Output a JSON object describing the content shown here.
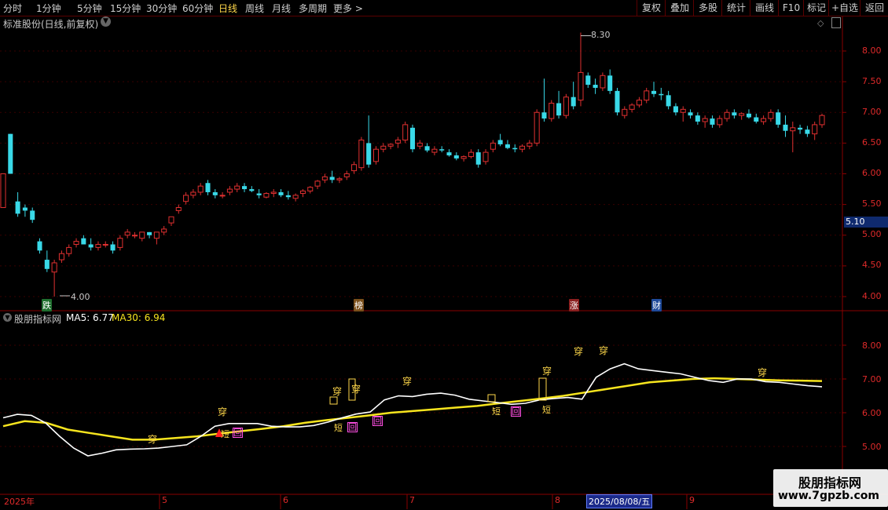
{
  "toolbar": {
    "periods": [
      "分时",
      "1分钟",
      "5分钟",
      "15分钟",
      "30分钟",
      "60分钟",
      "日线",
      "周线",
      "月线",
      "多周期",
      "更多 >"
    ],
    "active_period": "日线",
    "right_buttons": [
      "复权",
      "叠加",
      "多股",
      "统计",
      "画线",
      "F10",
      "标记",
      "+自选",
      "返回"
    ]
  },
  "main_panel": {
    "title": "标准股份(日线,前复权)",
    "high_marker": "8.30",
    "low_marker": "4.00",
    "price_ticks": [
      "8.00",
      "7.50",
      "7.00",
      "6.50",
      "6.00",
      "5.50",
      "5.00",
      "4.50",
      "4.00"
    ],
    "current_price_tag": "5.10",
    "events": [
      {
        "text": "跌",
        "color": "#2aa44a"
      },
      {
        "text": "榜",
        "color": "#c9822a"
      },
      {
        "text": "涨",
        "color": "#c0392b"
      },
      {
        "text": "财",
        "color": "#2a6cd0"
      }
    ]
  },
  "indicator_panel": {
    "name": "股朋指标网",
    "ma5_label": "MA5: 6.77",
    "ma30_label": "MA30: 6.94",
    "ticks": [
      "8.00",
      "7.00",
      "6.00",
      "5.00"
    ],
    "signals": {
      "chuan": "穿",
      "duan": "短",
      "hui": "回"
    }
  },
  "x_axis": {
    "labels": [
      "2025年",
      "5",
      "6",
      "7",
      "8",
      "9"
    ],
    "cursor_date": "2025/08/08/五"
  },
  "watermark": {
    "title": "股朋指标网",
    "url": "www.7gpzb.com"
  },
  "colors": {
    "up": "#e03030",
    "down": "#39d9e8",
    "ma5": "#ffffff",
    "ma30": "#f7e51e",
    "axis": "#8a0000"
  },
  "chart_data": {
    "type": "candlestick",
    "title": "标准股份(日线,前复权)",
    "ylim": [
      3.8,
      8.6
    ],
    "x_labels": [
      "2025年",
      "5",
      "6",
      "7",
      "8",
      "9"
    ],
    "high": 8.3,
    "low": 4.0,
    "ohlc": [
      [
        5.45,
        6.0,
        5.45,
        6.0
      ],
      [
        6.65,
        6.65,
        6.0,
        6.0
      ],
      [
        5.55,
        5.7,
        5.3,
        5.35
      ],
      [
        5.45,
        5.5,
        5.3,
        5.4
      ],
      [
        5.4,
        5.45,
        5.2,
        5.25
      ],
      [
        4.9,
        4.95,
        4.7,
        4.75
      ],
      [
        4.6,
        4.75,
        4.4,
        4.45
      ],
      [
        4.4,
        4.6,
        4.0,
        4.55
      ],
      [
        4.6,
        4.75,
        4.55,
        4.7
      ],
      [
        4.7,
        4.85,
        4.65,
        4.8
      ],
      [
        4.85,
        4.95,
        4.8,
        4.9
      ],
      [
        4.95,
        5.0,
        4.85,
        4.85
      ],
      [
        4.85,
        4.95,
        4.75,
        4.8
      ],
      [
        4.8,
        4.9,
        4.75,
        4.85
      ],
      [
        4.85,
        4.9,
        4.8,
        4.85
      ],
      [
        4.85,
        4.9,
        4.7,
        4.75
      ],
      [
        4.8,
        5.0,
        4.75,
        4.95
      ],
      [
        5.0,
        5.1,
        4.95,
        5.05
      ],
      [
        5.0,
        5.05,
        4.95,
        5.0
      ],
      [
        4.95,
        5.05,
        4.9,
        5.05
      ],
      [
        5.05,
        5.05,
        4.95,
        5.0
      ],
      [
        4.95,
        5.05,
        4.85,
        5.05
      ],
      [
        5.05,
        5.15,
        5.0,
        5.1
      ],
      [
        5.2,
        5.3,
        5.15,
        5.3
      ],
      [
        5.4,
        5.5,
        5.35,
        5.45
      ],
      [
        5.55,
        5.7,
        5.5,
        5.65
      ],
      [
        5.65,
        5.75,
        5.6,
        5.7
      ],
      [
        5.7,
        5.85,
        5.65,
        5.8
      ],
      [
        5.85,
        5.9,
        5.65,
        5.7
      ],
      [
        5.7,
        5.75,
        5.6,
        5.65
      ],
      [
        5.65,
        5.7,
        5.6,
        5.65
      ],
      [
        5.7,
        5.8,
        5.65,
        5.75
      ],
      [
        5.75,
        5.85,
        5.7,
        5.8
      ],
      [
        5.8,
        5.85,
        5.7,
        5.75
      ],
      [
        5.75,
        5.8,
        5.7,
        5.72
      ],
      [
        5.68,
        5.75,
        5.6,
        5.65
      ],
      [
        5.62,
        5.7,
        5.6,
        5.68
      ],
      [
        5.68,
        5.75,
        5.62,
        5.7
      ],
      [
        5.7,
        5.75,
        5.62,
        5.65
      ],
      [
        5.65,
        5.72,
        5.58,
        5.62
      ],
      [
        5.6,
        5.68,
        5.55,
        5.65
      ],
      [
        5.68,
        5.75,
        5.62,
        5.72
      ],
      [
        5.72,
        5.8,
        5.68,
        5.78
      ],
      [
        5.8,
        5.9,
        5.75,
        5.88
      ],
      [
        5.9,
        6.0,
        5.85,
        5.95
      ],
      [
        5.95,
        6.05,
        5.85,
        5.9
      ],
      [
        5.9,
        5.95,
        5.85,
        5.92
      ],
      [
        5.95,
        6.05,
        5.9,
        6.0
      ],
      [
        6.05,
        6.2,
        6.0,
        6.15
      ],
      [
        6.1,
        6.6,
        6.05,
        6.55
      ],
      [
        6.5,
        6.95,
        6.1,
        6.15
      ],
      [
        6.2,
        6.45,
        6.15,
        6.4
      ],
      [
        6.4,
        6.5,
        6.35,
        6.45
      ],
      [
        6.45,
        6.5,
        6.4,
        6.48
      ],
      [
        6.5,
        6.6,
        6.42,
        6.55
      ],
      [
        6.55,
        6.85,
        6.5,
        6.8
      ],
      [
        6.75,
        6.8,
        6.35,
        6.4
      ],
      [
        6.45,
        6.55,
        6.4,
        6.5
      ],
      [
        6.45,
        6.5,
        6.35,
        6.38
      ],
      [
        6.35,
        6.45,
        6.3,
        6.4
      ],
      [
        6.4,
        6.45,
        6.35,
        6.38
      ],
      [
        6.35,
        6.4,
        6.28,
        6.3
      ],
      [
        6.3,
        6.35,
        6.22,
        6.25
      ],
      [
        6.25,
        6.3,
        6.2,
        6.28
      ],
      [
        6.28,
        6.4,
        6.25,
        6.35
      ],
      [
        6.35,
        6.4,
        6.1,
        6.15
      ],
      [
        6.2,
        6.4,
        6.15,
        6.35
      ],
      [
        6.4,
        6.55,
        6.35,
        6.5
      ],
      [
        6.55,
        6.65,
        6.45,
        6.48
      ],
      [
        6.48,
        6.55,
        6.4,
        6.42
      ],
      [
        6.42,
        6.48,
        6.35,
        6.4
      ],
      [
        6.4,
        6.48,
        6.35,
        6.45
      ],
      [
        6.45,
        6.55,
        6.4,
        6.5
      ],
      [
        6.5,
        7.05,
        6.45,
        7.0
      ],
      [
        7.0,
        7.55,
        6.85,
        6.9
      ],
      [
        6.9,
        7.2,
        6.85,
        7.15
      ],
      [
        7.15,
        7.35,
        6.9,
        6.95
      ],
      [
        6.95,
        7.3,
        6.9,
        7.25
      ],
      [
        7.25,
        7.5,
        7.05,
        7.1
      ],
      [
        7.2,
        8.3,
        7.1,
        7.65
      ],
      [
        7.6,
        7.65,
        7.4,
        7.45
      ],
      [
        7.45,
        7.55,
        7.3,
        7.4
      ],
      [
        7.4,
        7.65,
        7.35,
        7.6
      ],
      [
        7.6,
        7.7,
        7.3,
        7.35
      ],
      [
        7.35,
        7.4,
        6.95,
        7.0
      ],
      [
        6.95,
        7.1,
        6.9,
        7.05
      ],
      [
        7.05,
        7.15,
        7.0,
        7.12
      ],
      [
        7.12,
        7.25,
        7.08,
        7.2
      ],
      [
        7.2,
        7.4,
        7.15,
        7.35
      ],
      [
        7.35,
        7.5,
        7.25,
        7.3
      ],
      [
        7.3,
        7.4,
        7.2,
        7.28
      ],
      [
        7.28,
        7.35,
        7.05,
        7.1
      ],
      [
        7.1,
        7.15,
        6.95,
        7.0
      ],
      [
        7.0,
        7.1,
        6.85,
        7.05
      ],
      [
        7.0,
        7.05,
        6.9,
        6.95
      ],
      [
        6.95,
        7.0,
        6.8,
        6.85
      ],
      [
        6.85,
        6.95,
        6.75,
        6.9
      ],
      [
        6.9,
        6.95,
        6.75,
        6.8
      ],
      [
        6.8,
        6.95,
        6.75,
        6.9
      ],
      [
        6.9,
        7.05,
        6.85,
        7.0
      ],
      [
        7.0,
        7.05,
        6.9,
        6.95
      ],
      [
        6.95,
        7.0,
        6.88,
        6.98
      ],
      [
        6.98,
        7.05,
        6.9,
        6.92
      ],
      [
        6.92,
        6.98,
        6.82,
        6.85
      ],
      [
        6.85,
        6.95,
        6.8,
        6.9
      ],
      [
        6.9,
        7.05,
        6.85,
        7.0
      ],
      [
        7.0,
        7.05,
        6.75,
        6.8
      ],
      [
        6.8,
        6.95,
        6.6,
        6.7
      ],
      [
        6.7,
        6.85,
        6.35,
        6.75
      ],
      [
        6.75,
        6.8,
        6.65,
        6.72
      ],
      [
        6.72,
        6.78,
        6.6,
        6.65
      ],
      [
        6.65,
        6.85,
        6.55,
        6.8
      ],
      [
        6.8,
        6.98,
        6.75,
        6.95
      ]
    ],
    "series": [
      {
        "name": "MA5",
        "values": [
          5.85,
          5.95,
          5.92,
          5.7,
          5.3,
          4.95,
          4.72,
          4.8,
          4.9,
          4.92,
          4.93,
          4.95,
          5.0,
          5.05,
          5.3,
          5.6,
          5.68,
          5.68,
          5.68,
          5.6,
          5.58,
          5.58,
          5.62,
          5.72,
          5.85,
          5.96,
          6.02,
          6.38,
          6.5,
          6.48,
          6.55,
          6.58,
          6.52,
          6.4,
          6.35,
          6.3,
          6.25,
          6.28,
          6.38,
          6.42,
          6.45,
          6.4,
          7.05,
          7.3,
          7.45,
          7.3,
          7.25,
          7.2,
          7.15,
          7.05,
          6.95,
          6.9,
          7.0,
          7.0,
          6.92,
          6.9,
          6.85,
          6.8,
          6.77
        ]
      },
      {
        "name": "MA30",
        "values": [
          5.6,
          5.75,
          5.7,
          5.5,
          5.4,
          5.3,
          5.2,
          5.2,
          5.25,
          5.3,
          5.38,
          5.45,
          5.52,
          5.6,
          5.7,
          5.78,
          5.85,
          5.92,
          6.0,
          6.05,
          6.1,
          6.15,
          6.2,
          6.28,
          6.35,
          6.42,
          6.5,
          6.6,
          6.7,
          6.8,
          6.9,
          6.95,
          7.0,
          7.02,
          7.0,
          6.98,
          6.96,
          6.95,
          6.94
        ]
      }
    ]
  }
}
